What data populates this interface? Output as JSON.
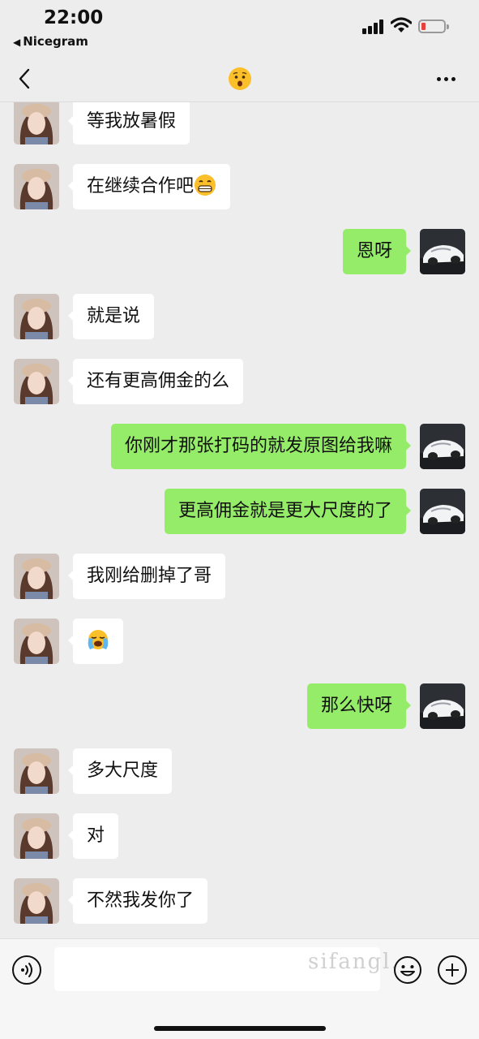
{
  "status_bar": {
    "time": "22:00",
    "back_app": "Nicegram",
    "back_arrow": "◀",
    "icons": [
      "signal-icon",
      "wifi-icon",
      "battery-low-icon"
    ],
    "battery_color": "#e8403a"
  },
  "nav": {
    "back_icon": "chevron-left-icon",
    "title_emoji": "worried-face-emoji",
    "more_icon": "more-dots-icon"
  },
  "colors": {
    "background": "#ededed",
    "incoming_bubble": "#ffffff",
    "outgoing_bubble": "#95ec69"
  },
  "messages": [
    {
      "side": "in",
      "text": "等我放暑假"
    },
    {
      "side": "in",
      "text": "在继续合作吧",
      "emoji": "grinning-face-emoji"
    },
    {
      "side": "out",
      "text": "恩呀"
    },
    {
      "side": "in",
      "text": "就是说"
    },
    {
      "side": "in",
      "text": "还有更高佣金的么"
    },
    {
      "side": "out",
      "text": "你刚才那张打码的就发原图给我嘛"
    },
    {
      "side": "out",
      "text": "更高佣金就是更大尺度的了"
    },
    {
      "side": "in",
      "text": "我刚给删掉了哥"
    },
    {
      "side": "in",
      "text": "",
      "emoji": "loudly-crying-face-emoji"
    },
    {
      "side": "out",
      "text": "那么快呀"
    },
    {
      "side": "in",
      "text": "多大尺度"
    },
    {
      "side": "in",
      "text": "对"
    },
    {
      "side": "in",
      "text": "不然我发你了"
    }
  ],
  "input_bar": {
    "voice_icon": "voice-icon",
    "text_value": "",
    "emoji_icon": "emoji-icon",
    "plus_icon": "plus-icon",
    "watermark": "sifangl..."
  }
}
